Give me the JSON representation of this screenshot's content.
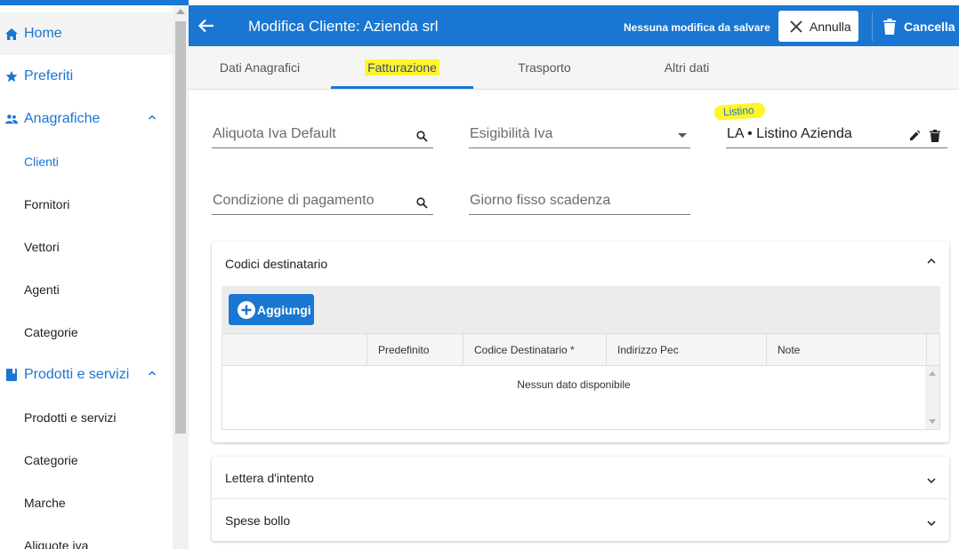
{
  "sidebar": {
    "home": "Home",
    "preferiti": "Preferiti",
    "anagrafiche": "Anagrafiche",
    "anagrafiche_items": [
      "Clienti",
      "Fornitori",
      "Vettori",
      "Agenti",
      "Categorie"
    ],
    "prodotti": "Prodotti e servizi",
    "prodotti_items": [
      "Prodotti e servizi",
      "Categorie",
      "Marche",
      "Aliquote iva"
    ]
  },
  "header": {
    "title": "Modifica Cliente: Azienda srl",
    "status": "Nessuna modifica da salvare",
    "annulla_label": "Annulla",
    "cancella_label": "Cancella"
  },
  "tabs": [
    "Dati Anagrafici",
    "Fatturazione",
    "Trasporto",
    "Altri dati"
  ],
  "form": {
    "aliquota_placeholder": "Aliquota Iva Default",
    "esigibilita_placeholder": "Esigibilità Iva",
    "listino_label": "Listino",
    "listino_value": "LA • Listino Azienda",
    "condizione_placeholder": "Condizione di pagamento",
    "giorno_placeholder": "Giorno fisso scadenza"
  },
  "codici": {
    "title": "Codici destinatario",
    "add_label": "Aggiungi",
    "columns": [
      "Predefinito",
      "Codice Destinatario *",
      "Indirizzo Pec",
      "Note"
    ],
    "empty_text": "Nessun dato disponibile"
  },
  "lettera": {
    "title": "Lettera d'intento"
  },
  "spese": {
    "title": "Spese bollo"
  },
  "colors": {
    "primary": "#1976d2",
    "highlight": "#fff52a"
  }
}
